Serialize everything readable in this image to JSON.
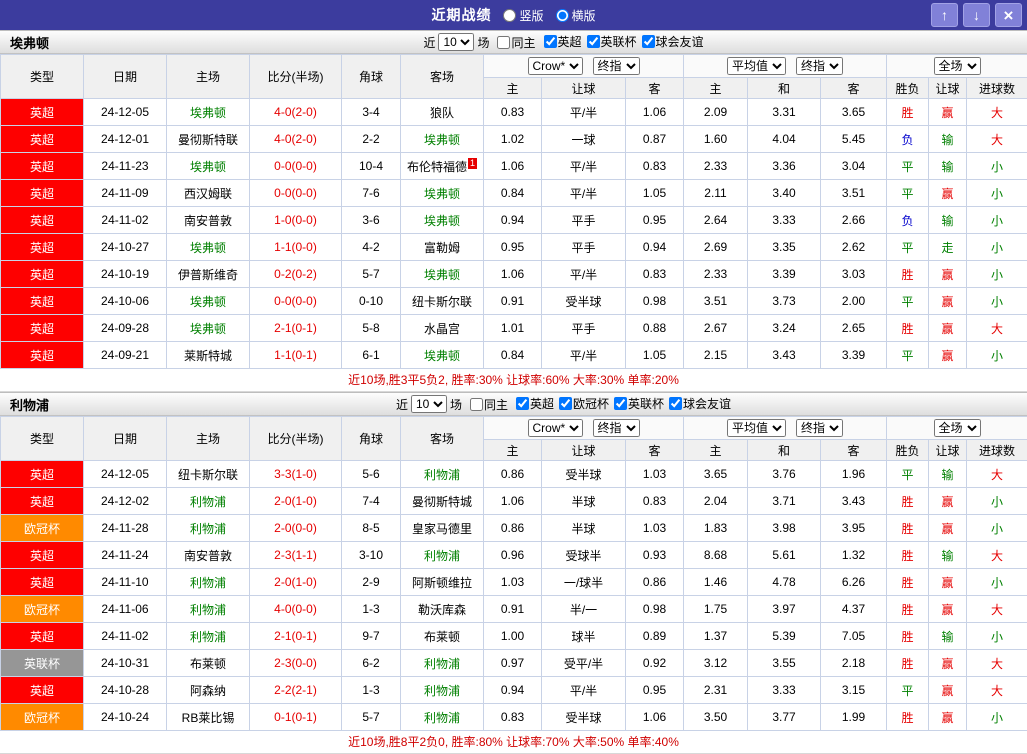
{
  "palette": {
    "topbar_bg": "#3c3c9e",
    "league_colors": {
      "英超": "#fe0000",
      "欧冠杯": "#ff8a00",
      "英联杯": "#969696"
    },
    "team_color": "#008000",
    "score_color": "#e60000",
    "result_colors": {
      "胜": "#e60000",
      "平": "#008000",
      "负": "#0000cc",
      "赢": "#e60000",
      "输": "#008000",
      "走": "#008000",
      "大": "#e60000",
      "小": "#008000"
    },
    "summary_color": "#d00000"
  },
  "topbar": {
    "title": "近期战绩",
    "vertical_label": "竖版",
    "horizontal_label": "横版",
    "selected_layout": "横版",
    "up_icon": "↑",
    "down_icon": "↓",
    "close_icon": "×"
  },
  "columns": {
    "type": "类型",
    "date": "日期",
    "home": "主场",
    "score": "比分(半场)",
    "corner": "角球",
    "away": "客场",
    "asia_home": "主",
    "asia_line": "让球",
    "asia_away": "客",
    "euro_home": "主",
    "euro_draw": "和",
    "euro_away": "客",
    "result": "胜负",
    "handicap_result": "让球",
    "goals": "进球数"
  },
  "sections": [
    {
      "team": "埃弗顿",
      "filters": {
        "near": "近",
        "count": "10",
        "unit": "场",
        "same_home": "同主",
        "same_home_checked": false,
        "leagues": [
          {
            "label": "英超",
            "checked": true
          },
          {
            "label": "英联杯",
            "checked": true
          },
          {
            "label": "球会友谊",
            "checked": true
          }
        ]
      },
      "dropdowns": {
        "asia_company": "Crow*",
        "asia_period": "终指",
        "euro_company": "平均值",
        "euro_period": "终指",
        "scope": "全场"
      },
      "rows": [
        {
          "league": "英超",
          "date": "24-12-05",
          "home": "埃弗顿",
          "score": "4-0(2-0)",
          "corner": "3-4",
          "away": "狼队",
          "asia_home": "0.83",
          "line": "平/半",
          "asia_away": "1.06",
          "euro_home": "2.09",
          "euro_draw": "3.31",
          "euro_away": "3.65",
          "result": "胜",
          "handicap": "赢",
          "goals": "大"
        },
        {
          "league": "英超",
          "date": "24-12-01",
          "home": "曼彻斯特联",
          "score": "4-0(2-0)",
          "corner": "2-2",
          "away": "埃弗顿",
          "asia_home": "1.02",
          "line": "一球",
          "asia_away": "0.87",
          "euro_home": "1.60",
          "euro_draw": "4.04",
          "euro_away": "5.45",
          "result": "负",
          "handicap": "输",
          "goals": "大"
        },
        {
          "league": "英超",
          "date": "24-11-23",
          "home": "埃弗顿",
          "score": "0-0(0-0)",
          "corner": "10-4",
          "away": "布伦特福德",
          "away_badge": "1",
          "asia_home": "1.06",
          "line": "平/半",
          "asia_away": "0.83",
          "euro_home": "2.33",
          "euro_draw": "3.36",
          "euro_away": "3.04",
          "result": "平",
          "handicap": "输",
          "goals": "小"
        },
        {
          "league": "英超",
          "date": "24-11-09",
          "home": "西汉姆联",
          "score": "0-0(0-0)",
          "corner": "7-6",
          "away": "埃弗顿",
          "asia_home": "0.84",
          "line": "平/半",
          "asia_away": "1.05",
          "euro_home": "2.11",
          "euro_draw": "3.40",
          "euro_away": "3.51",
          "result": "平",
          "handicap": "赢",
          "goals": "小"
        },
        {
          "league": "英超",
          "date": "24-11-02",
          "home": "南安普敦",
          "score": "1-0(0-0)",
          "corner": "3-6",
          "away": "埃弗顿",
          "asia_home": "0.94",
          "line": "平手",
          "asia_away": "0.95",
          "euro_home": "2.64",
          "euro_draw": "3.33",
          "euro_away": "2.66",
          "result": "负",
          "handicap": "输",
          "goals": "小"
        },
        {
          "league": "英超",
          "date": "24-10-27",
          "home": "埃弗顿",
          "score": "1-1(0-0)",
          "corner": "4-2",
          "away": "富勒姆",
          "asia_home": "0.95",
          "line": "平手",
          "asia_away": "0.94",
          "euro_home": "2.69",
          "euro_draw": "3.35",
          "euro_away": "2.62",
          "result": "平",
          "handicap": "走",
          "goals": "小"
        },
        {
          "league": "英超",
          "date": "24-10-19",
          "home": "伊普斯维奇",
          "score": "0-2(0-2)",
          "corner": "5-7",
          "away": "埃弗顿",
          "asia_home": "1.06",
          "line": "平/半",
          "asia_away": "0.83",
          "euro_home": "2.33",
          "euro_draw": "3.39",
          "euro_away": "3.03",
          "result": "胜",
          "handicap": "赢",
          "goals": "小"
        },
        {
          "league": "英超",
          "date": "24-10-06",
          "home": "埃弗顿",
          "score": "0-0(0-0)",
          "corner": "0-10",
          "away": "纽卡斯尔联",
          "asia_home": "0.91",
          "line": "受半球",
          "asia_away": "0.98",
          "euro_home": "3.51",
          "euro_draw": "3.73",
          "euro_away": "2.00",
          "result": "平",
          "handicap": "赢",
          "goals": "小"
        },
        {
          "league": "英超",
          "date": "24-09-28",
          "home": "埃弗顿",
          "score": "2-1(0-1)",
          "corner": "5-8",
          "away": "水晶宫",
          "asia_home": "1.01",
          "line": "平手",
          "asia_away": "0.88",
          "euro_home": "2.67",
          "euro_draw": "3.24",
          "euro_away": "2.65",
          "result": "胜",
          "handicap": "赢",
          "goals": "大"
        },
        {
          "league": "英超",
          "date": "24-09-21",
          "home": "莱斯特城",
          "score": "1-1(0-1)",
          "corner": "6-1",
          "away": "埃弗顿",
          "asia_home": "0.84",
          "line": "平/半",
          "asia_away": "1.05",
          "euro_home": "2.15",
          "euro_draw": "3.43",
          "euro_away": "3.39",
          "result": "平",
          "handicap": "赢",
          "goals": "小"
        }
      ],
      "summary": "近10场,胜3平5负2, 胜率:30% 让球率:60% 大率:30% 单率:20%"
    },
    {
      "team": "利物浦",
      "filters": {
        "near": "近",
        "count": "10",
        "unit": "场",
        "same_home": "同主",
        "same_home_checked": false,
        "leagues": [
          {
            "label": "英超",
            "checked": true
          },
          {
            "label": "欧冠杯",
            "checked": true
          },
          {
            "label": "英联杯",
            "checked": true
          },
          {
            "label": "球会友谊",
            "checked": true
          }
        ]
      },
      "dropdowns": {
        "asia_company": "Crow*",
        "asia_period": "终指",
        "euro_company": "平均值",
        "euro_period": "终指",
        "scope": "全场"
      },
      "rows": [
        {
          "league": "英超",
          "date": "24-12-05",
          "home": "纽卡斯尔联",
          "score": "3-3(1-0)",
          "corner": "5-6",
          "away": "利物浦",
          "asia_home": "0.86",
          "line": "受半球",
          "asia_away": "1.03",
          "euro_home": "3.65",
          "euro_draw": "3.76",
          "euro_away": "1.96",
          "result": "平",
          "handicap": "输",
          "goals": "大"
        },
        {
          "league": "英超",
          "date": "24-12-02",
          "home": "利物浦",
          "score": "2-0(1-0)",
          "corner": "7-4",
          "away": "曼彻斯特城",
          "asia_home": "1.06",
          "line": "半球",
          "asia_away": "0.83",
          "euro_home": "2.04",
          "euro_draw": "3.71",
          "euro_away": "3.43",
          "result": "胜",
          "handicap": "赢",
          "goals": "小"
        },
        {
          "league": "欧冠杯",
          "date": "24-11-28",
          "home": "利物浦",
          "score": "2-0(0-0)",
          "corner": "8-5",
          "away": "皇家马德里",
          "asia_home": "0.86",
          "line": "半球",
          "asia_away": "1.03",
          "euro_home": "1.83",
          "euro_draw": "3.98",
          "euro_away": "3.95",
          "result": "胜",
          "handicap": "赢",
          "goals": "小"
        },
        {
          "league": "英超",
          "date": "24-11-24",
          "home": "南安普敦",
          "score": "2-3(1-1)",
          "corner": "3-10",
          "away": "利物浦",
          "asia_home": "0.96",
          "line": "受球半",
          "asia_away": "0.93",
          "euro_home": "8.68",
          "euro_draw": "5.61",
          "euro_away": "1.32",
          "result": "胜",
          "handicap": "输",
          "goals": "大"
        },
        {
          "league": "英超",
          "date": "24-11-10",
          "home": "利物浦",
          "score": "2-0(1-0)",
          "corner": "2-9",
          "away": "阿斯顿维拉",
          "asia_home": "1.03",
          "line": "一/球半",
          "asia_away": "0.86",
          "euro_home": "1.46",
          "euro_draw": "4.78",
          "euro_away": "6.26",
          "result": "胜",
          "handicap": "赢",
          "goals": "小"
        },
        {
          "league": "欧冠杯",
          "date": "24-11-06",
          "home": "利物浦",
          "score": "4-0(0-0)",
          "corner": "1-3",
          "away": "勒沃库森",
          "asia_home": "0.91",
          "line": "半/一",
          "asia_away": "0.98",
          "euro_home": "1.75",
          "euro_draw": "3.97",
          "euro_away": "4.37",
          "result": "胜",
          "handicap": "赢",
          "goals": "大"
        },
        {
          "league": "英超",
          "date": "24-11-02",
          "home": "利物浦",
          "score": "2-1(0-1)",
          "corner": "9-7",
          "away": "布莱顿",
          "asia_home": "1.00",
          "line": "球半",
          "asia_away": "0.89",
          "euro_home": "1.37",
          "euro_draw": "5.39",
          "euro_away": "7.05",
          "result": "胜",
          "handicap": "输",
          "goals": "小"
        },
        {
          "league": "英联杯",
          "date": "24-10-31",
          "home": "布莱顿",
          "score": "2-3(0-0)",
          "corner": "6-2",
          "away": "利物浦",
          "asia_home": "0.97",
          "line": "受平/半",
          "asia_away": "0.92",
          "euro_home": "3.12",
          "euro_draw": "3.55",
          "euro_away": "2.18",
          "result": "胜",
          "handicap": "赢",
          "goals": "大"
        },
        {
          "league": "英超",
          "date": "24-10-28",
          "home": "阿森纳",
          "score": "2-2(2-1)",
          "corner": "1-3",
          "away": "利物浦",
          "asia_home": "0.94",
          "line": "平/半",
          "asia_away": "0.95",
          "euro_home": "2.31",
          "euro_draw": "3.33",
          "euro_away": "3.15",
          "result": "平",
          "handicap": "赢",
          "goals": "大"
        },
        {
          "league": "欧冠杯",
          "date": "24-10-24",
          "home": "RB莱比锡",
          "score": "0-1(0-1)",
          "corner": "5-7",
          "away": "利物浦",
          "asia_home": "0.83",
          "line": "受半球",
          "asia_away": "1.06",
          "euro_home": "3.50",
          "euro_draw": "3.77",
          "euro_away": "1.99",
          "result": "胜",
          "handicap": "赢",
          "goals": "小"
        }
      ],
      "summary": "近10场,胜8平2负0, 胜率:80% 让球率:70% 大率:50% 单率:40%"
    }
  ]
}
